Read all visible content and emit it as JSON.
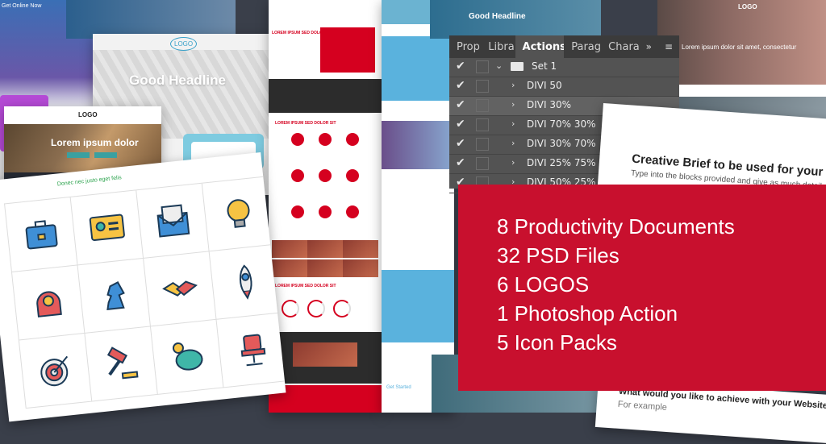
{
  "mock_left": {
    "caption": "Get Online Now"
  },
  "mock_headline": {
    "logo": "LOGO",
    "headline": "Good Headline"
  },
  "mock_lorem": {
    "logo": "LOGO",
    "headline": "Lorem ipsum dolor"
  },
  "icon_sheet": {
    "title": "Donec nec justo eget felis",
    "icons": [
      "briefcase-icon",
      "id-card-icon",
      "envelope-icon",
      "lightbulb-icon",
      "head-gear-icon",
      "chess-knight-icon",
      "handshake-icon",
      "rocket-icon",
      "target-icon",
      "gavel-icon",
      "piggy-bank-icon",
      "office-chair-icon"
    ]
  },
  "mock_red": {
    "section_title": "LOREM IPSUM SED DOLOR SIT"
  },
  "mock_gh2": {
    "headline": "Good Headline"
  },
  "mock_food": {
    "logo": "LOGO",
    "sub": "Lorem ipsum dolor sit amet, consectetur"
  },
  "mock_bottom": {
    "cta": "Get Started"
  },
  "ps_panel": {
    "tabs": [
      "Prop",
      "Libra",
      "Actions",
      "Parag",
      "Chara"
    ],
    "active_tab": "Actions",
    "set_name": "Set 1",
    "actions": [
      "DIVI 50",
      "DIVI 30%",
      "DIVI 70% 30%",
      "DIVI 30% 70%",
      "DIVI 25% 75%",
      "DIVI 50% 25% 25%"
    ],
    "selected_index": 1
  },
  "creative_brief": {
    "title": "Creative Brief to be used for your We",
    "subtitle": "Type into the blocks provided and give as much detail as possible",
    "question": "What would you like to achieve with your Website",
    "question_hint": "For example"
  },
  "promo": {
    "items": [
      "8 Productivity Documents",
      "32 PSD Files",
      "6 LOGOS",
      "1 Photoshop Action",
      "5 Icon Packs"
    ],
    "background": "#c8102e"
  },
  "colors": {
    "accent_red": "#d5001f",
    "ps_panel_bg": "#535353",
    "teal": "#7ecbe0"
  }
}
